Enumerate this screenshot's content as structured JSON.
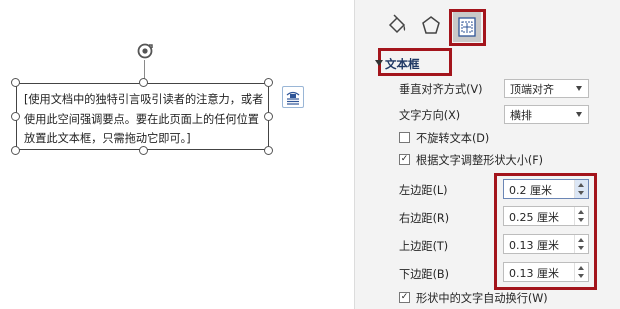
{
  "document": {
    "textbox_text": "[使用文档中的独特引言吸引读者的注意力，或者使用此空间强调要点。要在此页面上的任何位置放置此文本框，只需拖动它即可。]"
  },
  "pane": {
    "tabs": [
      {
        "name": "fill-line",
        "icon": "paint-bucket-icon"
      },
      {
        "name": "effects",
        "icon": "pentagon-icon"
      },
      {
        "name": "layout-properties",
        "icon": "layout-properties-icon",
        "active": true
      }
    ],
    "section_title": "文本框",
    "vertical_align": {
      "label": "垂直对齐方式(V)",
      "value": "顶端对齐"
    },
    "text_direction": {
      "label": "文字方向(X)",
      "value": "横排"
    },
    "no_rotate": {
      "label": "不旋转文本(D)",
      "checked": false
    },
    "autofit": {
      "label": "根据文字调整形状大小(F)",
      "checked": true
    },
    "margins": [
      {
        "label": "左边距(L)",
        "value": "0.2 厘米"
      },
      {
        "label": "右边距(R)",
        "value": "0.25 厘米"
      },
      {
        "label": "上边距(T)",
        "value": "0.13 厘米"
      },
      {
        "label": "下边距(B)",
        "value": "0.13 厘米"
      }
    ],
    "wrap_text": {
      "label": "形状中的文字自动换行(W)",
      "checked": true
    }
  },
  "colors": {
    "highlight": "#a3141b",
    "section_title": "#1f3864"
  }
}
